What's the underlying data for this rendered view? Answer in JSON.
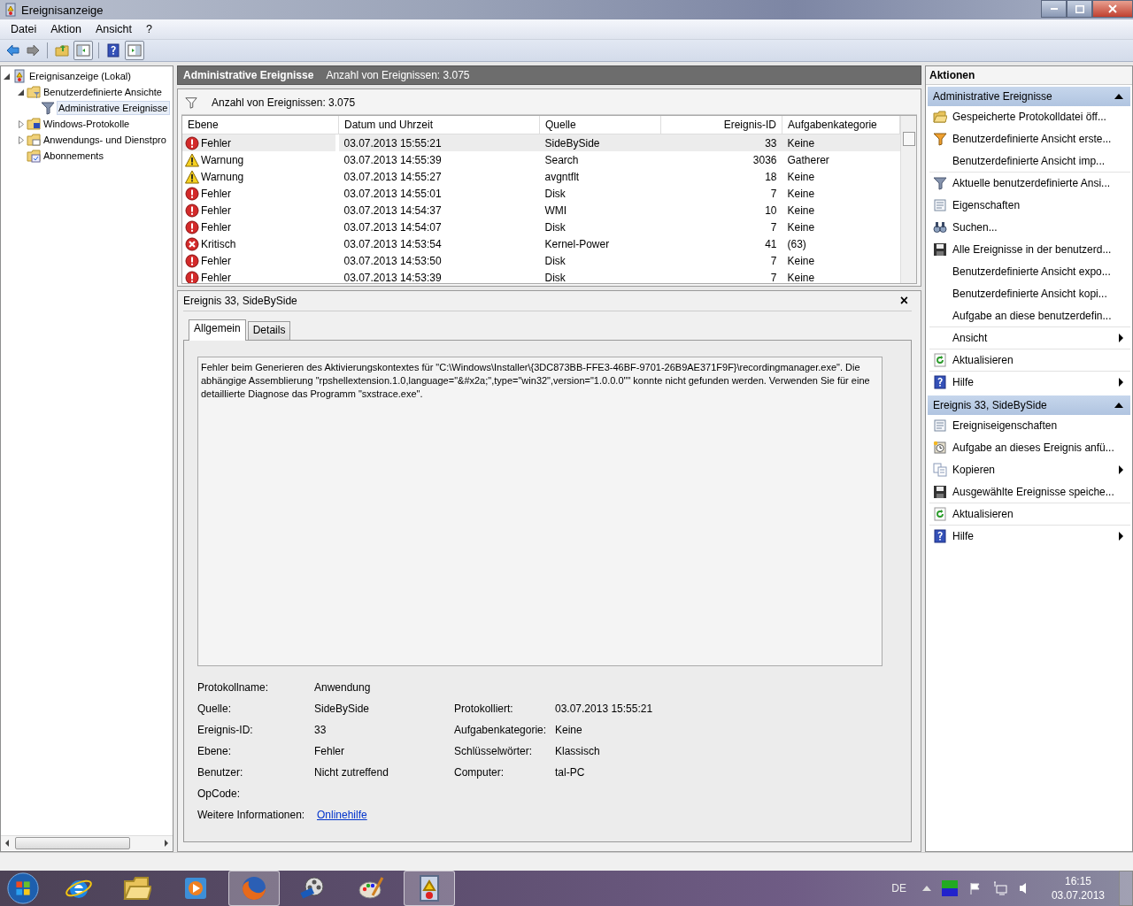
{
  "window": {
    "title": "Ereignisanzeige"
  },
  "menu": [
    "Datei",
    "Aktion",
    "Ansicht",
    "?"
  ],
  "tree": [
    {
      "label": "Ereignisanzeige (Lokal)",
      "expanded": true,
      "expandable": true,
      "selected": false,
      "children": [
        {
          "label": "Benutzerdefinierte Ansichte",
          "expanded": true,
          "expandable": true,
          "selected": false,
          "children": [
            {
              "label": "Administrative Ereignisse",
              "expandable": false,
              "selected": true
            }
          ]
        },
        {
          "label": "Windows-Protokolle",
          "expanded": false,
          "expandable": true,
          "selected": false
        },
        {
          "label": "Anwendungs- und Dienstpro",
          "expanded": false,
          "expandable": true,
          "selected": false
        },
        {
          "label": "Abonnements",
          "expandable": false,
          "selected": false
        }
      ]
    }
  ],
  "center": {
    "title": "Administrative Ereignisse",
    "count": "Anzahl von Ereignissen: 3.075",
    "filter_text": "Anzahl von Ereignissen: 3.075"
  },
  "table": {
    "columns": [
      "Ebene",
      "Datum und Uhrzeit",
      "Quelle",
      "Ereignis-ID",
      "Aufgabenkategorie"
    ],
    "rows": [
      {
        "kind": "error",
        "level": "Fehler",
        "date": "03.07.2013 15:55:21",
        "source": "SideBySide",
        "id": "33",
        "category": "Keine",
        "selected": true
      },
      {
        "kind": "warning",
        "level": "Warnung",
        "date": "03.07.2013 14:55:39",
        "source": "Search",
        "id": "3036",
        "category": "Gatherer",
        "selected": false
      },
      {
        "kind": "warning",
        "level": "Warnung",
        "date": "03.07.2013 14:55:27",
        "source": "avgntflt",
        "id": "18",
        "category": "Keine",
        "selected": false
      },
      {
        "kind": "error",
        "level": "Fehler",
        "date": "03.07.2013 14:55:01",
        "source": "Disk",
        "id": "7",
        "category": "Keine",
        "selected": false
      },
      {
        "kind": "error",
        "level": "Fehler",
        "date": "03.07.2013 14:54:37",
        "source": "WMI",
        "id": "10",
        "category": "Keine",
        "selected": false
      },
      {
        "kind": "error",
        "level": "Fehler",
        "date": "03.07.2013 14:54:07",
        "source": "Disk",
        "id": "7",
        "category": "Keine",
        "selected": false
      },
      {
        "kind": "critical",
        "level": "Kritisch",
        "date": "03.07.2013 14:53:54",
        "source": "Kernel-Power",
        "id": "41",
        "category": "(63)",
        "selected": false
      },
      {
        "kind": "error",
        "level": "Fehler",
        "date": "03.07.2013 14:53:50",
        "source": "Disk",
        "id": "7",
        "category": "Keine",
        "selected": false
      },
      {
        "kind": "error",
        "level": "Fehler",
        "date": "03.07.2013 14:53:39",
        "source": "Disk",
        "id": "7",
        "category": "Keine",
        "selected": false
      }
    ]
  },
  "detail": {
    "title": "Ereignis 33, SideBySide",
    "close": "×",
    "tabs": [
      {
        "label": "Allgemein",
        "selected": true
      },
      {
        "label": "Details",
        "selected": false
      }
    ],
    "message": "Fehler beim Generieren des Aktivierungskontextes für \"C:\\Windows\\Installer\\{3DC873BB-FFE3-46BF-9701-26B9AE371F9F}\\recordingmanager.exe\". Die abhängige Assemblierung \"rpshellextension.1.0,language=\"&#x2a;\",type=\"win32\",version=\"1.0.0.0\"\" konnte nicht gefunden werden. Verwenden Sie für eine detaillierte Diagnose das Programm \"sxstrace.exe\".",
    "fields": [
      {
        "label": "Protokollname:",
        "value": "Anwendung"
      },
      {
        "label": "Quelle:",
        "value": "SideBySide",
        "label2": "Protokolliert:",
        "value2": "03.07.2013 15:55:21"
      },
      {
        "label": "Ereignis-ID:",
        "value": "33",
        "label2": "Aufgabenkategorie:",
        "value2": "Keine"
      },
      {
        "label": "Ebene:",
        "value": "Fehler",
        "label2": "Schlüsselwörter:",
        "value2": "Klassisch"
      },
      {
        "label": "Benutzer:",
        "value": "Nicht zutreffend",
        "label2": "Computer:",
        "value2": "tal-PC"
      },
      {
        "label": "OpCode:"
      },
      {
        "label": "Weitere Informationen:",
        "link": "Onlinehilfe"
      }
    ]
  },
  "actions": {
    "title": "Aktionen",
    "sections": [
      {
        "title": "Administrative Ereignisse",
        "expanded": true,
        "items": [
          {
            "label": "Gespeicherte Protokolldatei öff...",
            "submenu": false,
            "separator": false
          },
          {
            "label": "Benutzerdefinierte Ansicht erste...",
            "submenu": false,
            "separator": false
          },
          {
            "label": "Benutzerdefinierte Ansicht imp...",
            "submenu": false,
            "separator": true
          },
          {
            "label": "Aktuelle benutzerdefinierte Ansi...",
            "submenu": false,
            "separator": false
          },
          {
            "label": "Eigenschaften",
            "submenu": false,
            "separator": false
          },
          {
            "label": "Suchen...",
            "submenu": false,
            "separator": false
          },
          {
            "label": "Alle Ereignisse in der benutzerd...",
            "submenu": false,
            "separator": false
          },
          {
            "label": "Benutzerdefinierte Ansicht expo...",
            "submenu": false,
            "separator": false
          },
          {
            "label": "Benutzerdefinierte Ansicht kopi...",
            "submenu": false,
            "separator": false
          },
          {
            "label": "Aufgabe an diese benutzerdefin...",
            "submenu": false,
            "separator": true
          },
          {
            "label": "Ansicht",
            "submenu": true,
            "separator": true
          },
          {
            "label": "Aktualisieren",
            "submenu": false,
            "separator": true
          },
          {
            "label": "Hilfe",
            "submenu": true,
            "separator": false
          }
        ]
      },
      {
        "title": "Ereignis 33, SideBySide",
        "expanded": true,
        "items": [
          {
            "label": "Ereigniseigenschaften",
            "submenu": false,
            "separator": false
          },
          {
            "label": "Aufgabe an dieses Ereignis anfü...",
            "submenu": false,
            "separator": false
          },
          {
            "label": "Kopieren",
            "submenu": true,
            "separator": false
          },
          {
            "label": "Ausgewählte Ereignisse speiche...",
            "submenu": false,
            "separator": true
          },
          {
            "label": "Aktualisieren",
            "submenu": false,
            "separator": true
          },
          {
            "label": "Hilfe",
            "submenu": true,
            "separator": false
          }
        ]
      }
    ]
  },
  "taskbar": {
    "items": [
      {
        "active": false
      },
      {
        "active": false
      },
      {
        "active": false
      },
      {
        "active": true
      },
      {
        "active": false
      },
      {
        "active": false
      },
      {
        "active": true
      }
    ],
    "language": "DE",
    "time": "16:15",
    "date": "03.07.2013"
  }
}
